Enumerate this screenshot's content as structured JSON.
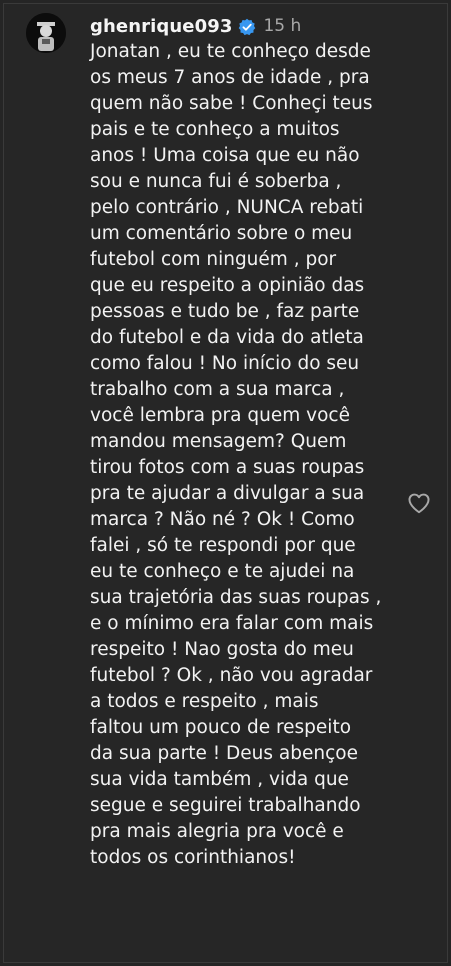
{
  "comment": {
    "username": "ghenrique093",
    "timestamp": "15 h",
    "lines": [
      "Jonatan , eu te conheço desde",
      "os meus 7 anos de idade , pra",
      "quem não sabe ! Conheçi teus",
      "pais e te conheço a muitos",
      "anos ! Uma coisa que eu não",
      "sou e nunca fui é soberba ,",
      "pelo contrário , NUNCA rebati",
      "um comentário sobre o meu",
      "futebol com ninguém , por",
      "que eu respeito a opinião das",
      "pessoas e tudo be , faz parte",
      "do futebol e da vida do atleta",
      "como falou ! No início do seu",
      "trabalho com a sua marca ,",
      "você lembra pra quem você",
      "mandou mensagem? Quem",
      "tirou fotos com a suas roupas",
      "pra te ajudar a divulgar a sua",
      "marca ? Não né ? Ok ! Como",
      "falei , só te respondi por que",
      "eu te conheço e te ajudei na",
      "sua trajetória das suas roupas ,",
      "e o mínimo era falar com mais",
      "respeito ! Nao gosta do meu",
      "futebol ? Ok , não vou agradar",
      "a todos e respeito , mais",
      "faltou um pouco de respeito",
      "da sua parte ! Deus abençoe",
      "sua vida também , vida que",
      "segue e seguirei trabalhando",
      "pra mais alegria pra você e",
      "todos os corinthianos!"
    ]
  },
  "icons": {
    "verified": "verified-badge-icon",
    "like": "heart-outline-icon"
  },
  "colors": {
    "background": "#262626",
    "text": "#f2f2f2",
    "muted": "#a8a8a8",
    "verified": "#3897f0"
  }
}
